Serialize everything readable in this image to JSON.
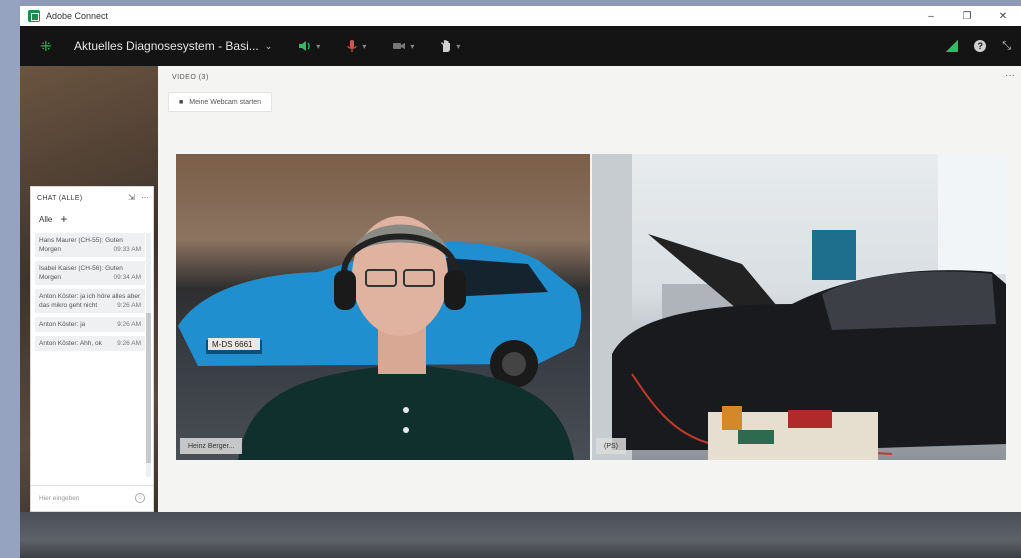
{
  "window": {
    "app_title": "Adobe Connect",
    "controls": [
      "–",
      "❐",
      "✕"
    ]
  },
  "topbar": {
    "room_title": "Aktuelles Diagnosesystem - Basi...",
    "room_chevron": "⌄",
    "icons": [
      "grid-icon",
      "speaker-icon",
      "microphone-icon",
      "camera-icon",
      "raise-hand-icon",
      "signal-icon",
      "help-icon",
      "fullscreen-icon"
    ],
    "accent_green": "#2ebd63",
    "mic_red": "#d9534f"
  },
  "video_pod": {
    "header": "VIDEO (3)",
    "menu": "···",
    "webcam_button": "Meine Webcam starten",
    "tiles": [
      {
        "label": "Heinz Berger..."
      },
      {
        "label": "(PS)"
      }
    ],
    "car_plate": "M-DS 6661"
  },
  "chat_pod": {
    "header": "CHAT (ALLE)",
    "collapse": "⇲",
    "menu": "···",
    "tab_all": "Alle",
    "tab_add": "+",
    "messages": [
      {
        "text": "Hans Maurer (CH-55): Guten Morgen",
        "time": "09:33 AM"
      },
      {
        "text": "Isabel Kaiser (CH-56): Guten Morgen",
        "time": "09:34 AM"
      },
      {
        "text": "Anton Köster: ja ich höre alles aber das mikro geht nicht",
        "time": "9:26 AM"
      },
      {
        "text": "Anton Köster: ja",
        "time": "9:26 AM"
      },
      {
        "text": "Anton Köster: Ahh, ok",
        "time": "9:26 AM"
      }
    ],
    "input_placeholder": "Hier eingeben"
  }
}
